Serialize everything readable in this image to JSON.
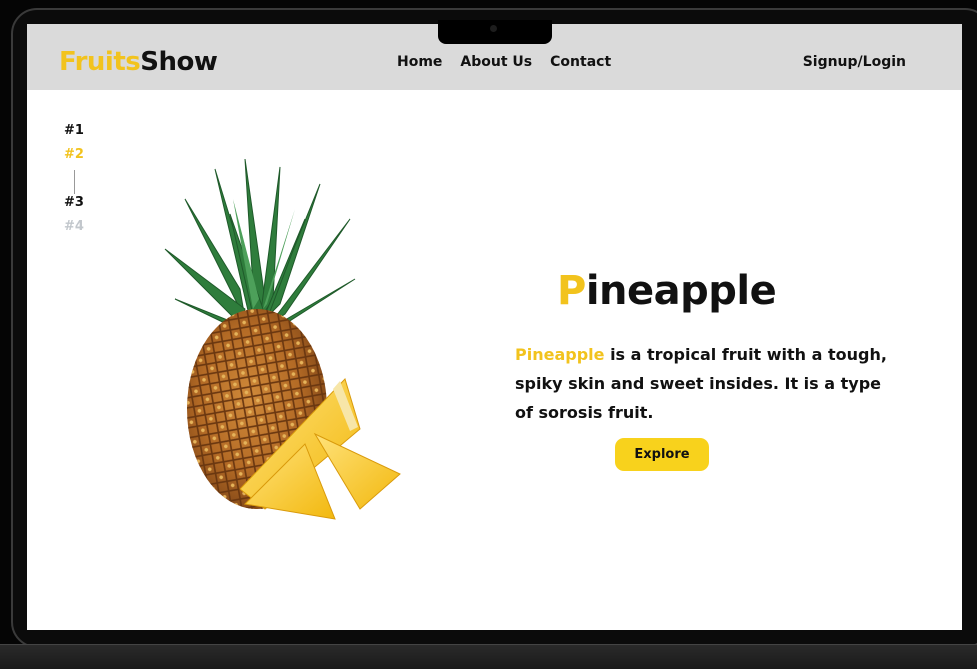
{
  "brand": {
    "name_part1": "Fruits",
    "name_part2": "Show"
  },
  "nav": {
    "items": [
      "Home",
      "About Us",
      "Contact"
    ],
    "auth_label": "Signup/Login"
  },
  "pager": {
    "items": [
      "#1",
      "#2",
      "#3",
      "#4"
    ],
    "active_index": 1
  },
  "hero": {
    "title_first_letter": "P",
    "title_rest": "ineapple",
    "description_highlight": "Pineapple",
    "description_rest": " is a tropical fruit with a tough, spiky skin and sweet insides. It is a type of sorosis fruit.",
    "button_label": "Explore"
  },
  "colors": {
    "accent": "#f2c31d",
    "navbar_bg": "#dadada",
    "button_bg": "#f8d21c"
  },
  "icons": {
    "image": "pineapple-image"
  }
}
